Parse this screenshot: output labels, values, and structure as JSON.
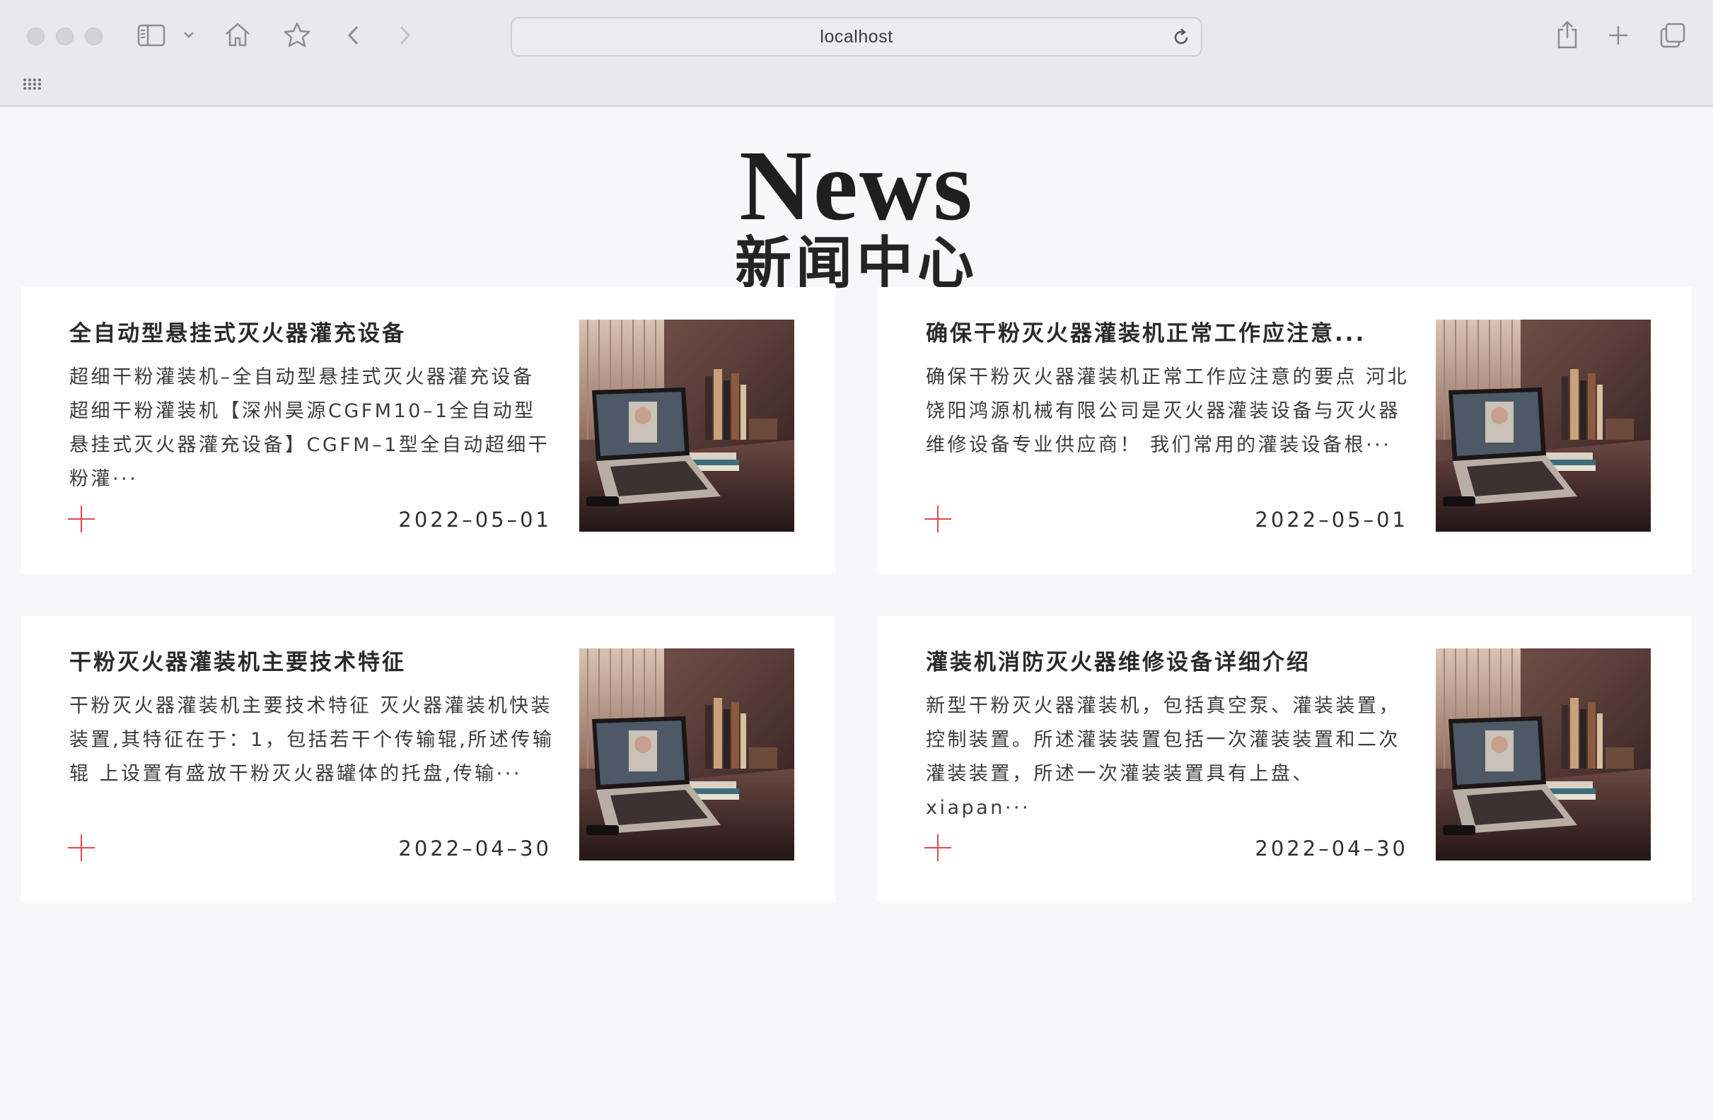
{
  "browser": {
    "url": "localhost"
  },
  "page": {
    "heading_en": "News",
    "heading_cn": "新闻中心"
  },
  "news": [
    {
      "title": "全自动型悬挂式灭火器灌充设备",
      "summary": "超细干粉灌装机–全自动型悬挂式灭火器灌充设备 超细干粉灌装机【深州昊源CGFM10–1全自动型悬挂式灭火器灌充设备】CGFM–1型全自动超细干粉灌···",
      "date": "2022–05–01"
    },
    {
      "title": "确保干粉灭火器灌装机正常工作应注意...",
      "summary": "确保干粉灭火器灌装机正常工作应注意的要点 河北饶阳鸿源机械有限公司是灭火器灌装设备与灭火器维修设备专业供应商！ 我们常用的灌装设备根···",
      "date": "2022–05–01"
    },
    {
      "title": "干粉灭火器灌装机主要技术特征",
      "summary": "干粉灭火器灌装机主要技术特征 灭火器灌装机快装装置,其特征在于：1，包括若干个传输辊,所述传输辊 上设置有盛放干粉灭火器罐体的托盘,传输···",
      "date": "2022–04–30"
    },
    {
      "title": "灌装机消防灭火器维修设备详细介绍",
      "summary": "新型干粉灭火器灌装机，包括真空泵、灌装装置，控制装置。所述灌装装置包括一次灌装装置和二次灌装装置，所述一次灌装装置具有上盘、xiapan···",
      "date": "2022–04–30"
    }
  ],
  "colors": {
    "accent": "#e0494b",
    "page_bg": "#f7f6f8",
    "card_bg": "#ffffff"
  }
}
